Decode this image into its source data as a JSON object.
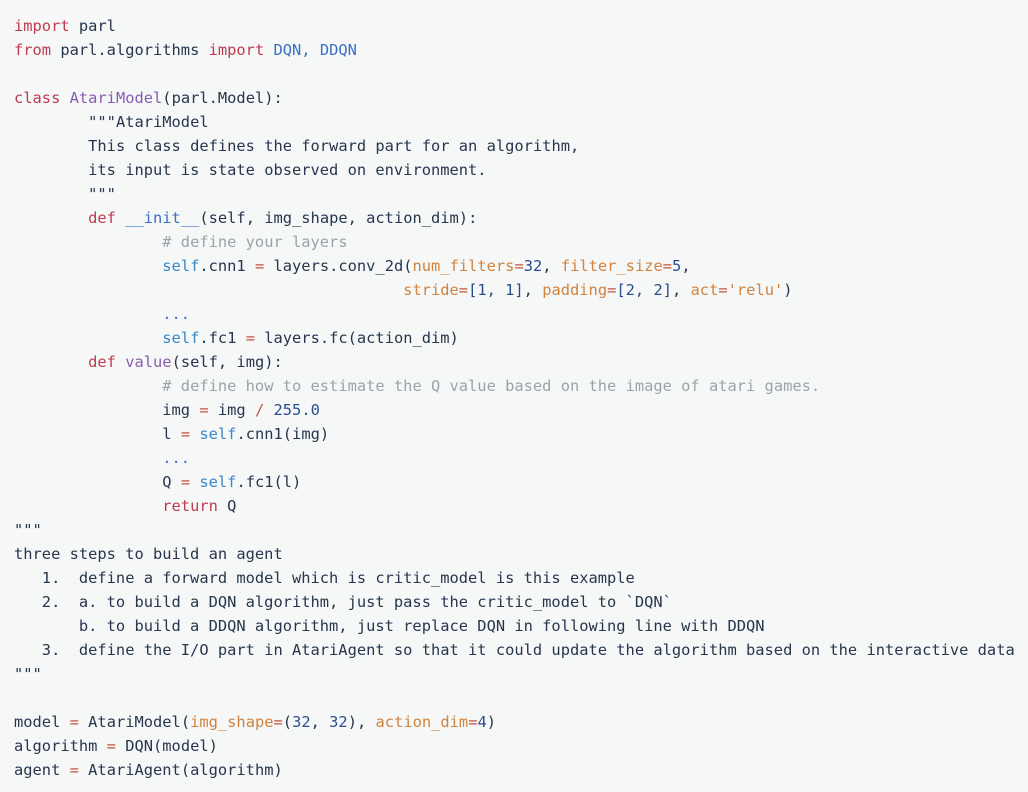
{
  "document": {
    "kind": "python-code-snippet",
    "language": "Python",
    "background_color": "#f6f8f8",
    "default_text_color": "#27364d",
    "font_size_px": 15.4,
    "line_height_px": 24,
    "palette": {
      "keyword": "#bf3a4f",
      "class_name": "#8a5cb0",
      "function_name": "#3a6fc4",
      "self": "#3a86c8",
      "operator": "#c4553c",
      "kwarg": "#d2823c",
      "string": "#d2823c",
      "number": "#2a4d8f",
      "comment": "#9aa3ab",
      "docstring": "#27364d"
    }
  },
  "lines": [
    {
      "n": 1,
      "text": "import parl"
    },
    {
      "n": 2,
      "text": "from parl.algorithms import DQN, DDQN"
    },
    {
      "n": 3,
      "text": ""
    },
    {
      "n": 4,
      "text": "class AtariModel(parl.Model):"
    },
    {
      "n": 5,
      "text": "        \"\"\"AtariModel"
    },
    {
      "n": 6,
      "text": "        This class defines the forward part for an algorithm,"
    },
    {
      "n": 7,
      "text": "        its input is state observed on environment."
    },
    {
      "n": 8,
      "text": "        \"\"\""
    },
    {
      "n": 9,
      "text": "        def __init__(self, img_shape, action_dim):"
    },
    {
      "n": 10,
      "text": "                # define your layers"
    },
    {
      "n": 11,
      "text": "                self.cnn1 = layers.conv_2d(num_filters=32, filter_size=5,"
    },
    {
      "n": 12,
      "text": "                                          stride=[1, 1], padding=[2, 2], act='relu')"
    },
    {
      "n": 13,
      "text": "                ..."
    },
    {
      "n": 14,
      "text": "                self.fc1 = layers.fc(action_dim)"
    },
    {
      "n": 15,
      "text": "        def value(self, img):"
    },
    {
      "n": 16,
      "text": "                # define how to estimate the Q value based on the image of atari games."
    },
    {
      "n": 17,
      "text": "                img = img / 255.0"
    },
    {
      "n": 18,
      "text": "                l = self.cnn1(img)"
    },
    {
      "n": 19,
      "text": "                ..."
    },
    {
      "n": 20,
      "text": "                Q = self.fc1(l)"
    },
    {
      "n": 21,
      "text": "                return Q"
    },
    {
      "n": 22,
      "text": "\"\"\""
    },
    {
      "n": 23,
      "text": "three steps to build an agent"
    },
    {
      "n": 24,
      "text": "   1.  define a forward model which is critic_model is this example"
    },
    {
      "n": 25,
      "text": "   2.  a. to build a DQN algorithm, just pass the critic_model to `DQN`"
    },
    {
      "n": 26,
      "text": "       b. to build a DDQN algorithm, just replace DQN in following line with DDQN"
    },
    {
      "n": 27,
      "text": "   3.  define the I/O part in AtariAgent so that it could update the algorithm based on the interactive data"
    },
    {
      "n": 28,
      "text": "\"\"\""
    },
    {
      "n": 29,
      "text": ""
    },
    {
      "n": 30,
      "text": "model = AtariModel(img_shape=(32, 32), action_dim=4)"
    },
    {
      "n": 31,
      "text": "algorithm = DQN(model)"
    },
    {
      "n": 32,
      "text": "agent = AtariAgent(algorithm)"
    }
  ],
  "tokens": {
    "l1": {
      "kw": "import",
      "rest": " parl"
    },
    "l2": {
      "kw1": "from",
      "mod": " parl.algorithms ",
      "kw2": "import",
      "names": " DQN, DDQN"
    },
    "l4": {
      "kw": "class",
      "name": " AtariModel",
      "paren_open": "(",
      "base": "parl.Model",
      "paren_close": "):"
    },
    "l5": {
      "indent": "        ",
      "text": "\"\"\"AtariModel"
    },
    "l6": {
      "indent": "        ",
      "text": "This class defines the forward part for an algorithm,"
    },
    "l7": {
      "indent": "        ",
      "text": "its input is state observed on environment."
    },
    "l8": {
      "indent": "        ",
      "text": "\"\"\""
    },
    "l9": {
      "indent": "        ",
      "kw": "def",
      "name": " __init__",
      "args": "(self, img_shape, action_dim):"
    },
    "l10": {
      "indent": "                ",
      "comment": "# define your layers"
    },
    "l11": {
      "indent": "                ",
      "self": "self",
      "attr": ".cnn1 ",
      "op": "=",
      "call": " layers.conv_2d(",
      "kwarg1": "num_filters",
      "eq1": "=",
      "num1": "32",
      "sep1": ", ",
      "kwarg2": "filter_size",
      "eq2": "=",
      "num2": "5",
      "sep2": ","
    },
    "l12": {
      "indent": "                                          ",
      "kwarg1": "stride",
      "eq1": "=",
      "val1": "[1, 1]",
      "sep1": ", ",
      "kwarg2": "padding",
      "eq2": "=",
      "val2": "[2, 2]",
      "sep2": ", ",
      "kwarg3": "act",
      "eq3": "=",
      "str3": "'relu'",
      "close": ")"
    },
    "l13": {
      "indent": "                ",
      "ellipsis": "..."
    },
    "l14": {
      "indent": "                ",
      "self": "self",
      "attr": ".fc1 ",
      "op": "=",
      "call": " layers.fc(action_dim)"
    },
    "l15": {
      "indent": "        ",
      "kw": "def",
      "name": " value",
      "args": "(self, img):"
    },
    "l16": {
      "indent": "                ",
      "comment": "# define how to estimate the Q value based on the image of atari games."
    },
    "l17": {
      "indent": "                ",
      "lhs": "img ",
      "op1": "=",
      "mid": " img ",
      "op2": "/",
      "num": " 255.0"
    },
    "l18": {
      "indent": "                ",
      "lhs": "l ",
      "op": "=",
      "sp": " ",
      "self": "self",
      "rest": ".cnn1(img)"
    },
    "l19": {
      "indent": "                ",
      "ellipsis": "..."
    },
    "l20": {
      "indent": "                ",
      "lhs": "Q ",
      "op": "=",
      "sp": " ",
      "self": "self",
      "rest": ".fc1(l)"
    },
    "l21": {
      "indent": "                ",
      "kw": "return",
      "rest": " Q"
    },
    "l22": {
      "text": "\"\"\""
    },
    "l23": {
      "text": "three steps to build an agent"
    },
    "l24": {
      "text": "   1.  define a forward model which is critic_model is this example"
    },
    "l25": {
      "text": "   2.  a. to build a DQN algorithm, just pass the critic_model to `DQN`"
    },
    "l26": {
      "text": "       b. to build a DDQN algorithm, just replace DQN in following line with DDQN"
    },
    "l27": {
      "text": "   3.  define the I/O part in AtariAgent so that it could update the algorithm based on the interactive data"
    },
    "l28": {
      "text": "\"\"\""
    },
    "l30": {
      "lhs": "model ",
      "op": "=",
      "call": " AtariModel(",
      "kwarg1": "img_shape",
      "eq1": "=",
      "tuple1": "(",
      "n1": "32",
      "comma1": ", ",
      "n2": "32",
      "tupleclose": ")",
      "sep": ", ",
      "kwarg2": "action_dim",
      "eq2": "=",
      "n3": "4",
      "close": ")"
    },
    "l31": {
      "lhs": "algorithm ",
      "op": "=",
      "rest": " DQN(model)"
    },
    "l32": {
      "lhs": "agent ",
      "op": "=",
      "rest": " AtariAgent(algorithm)"
    }
  }
}
